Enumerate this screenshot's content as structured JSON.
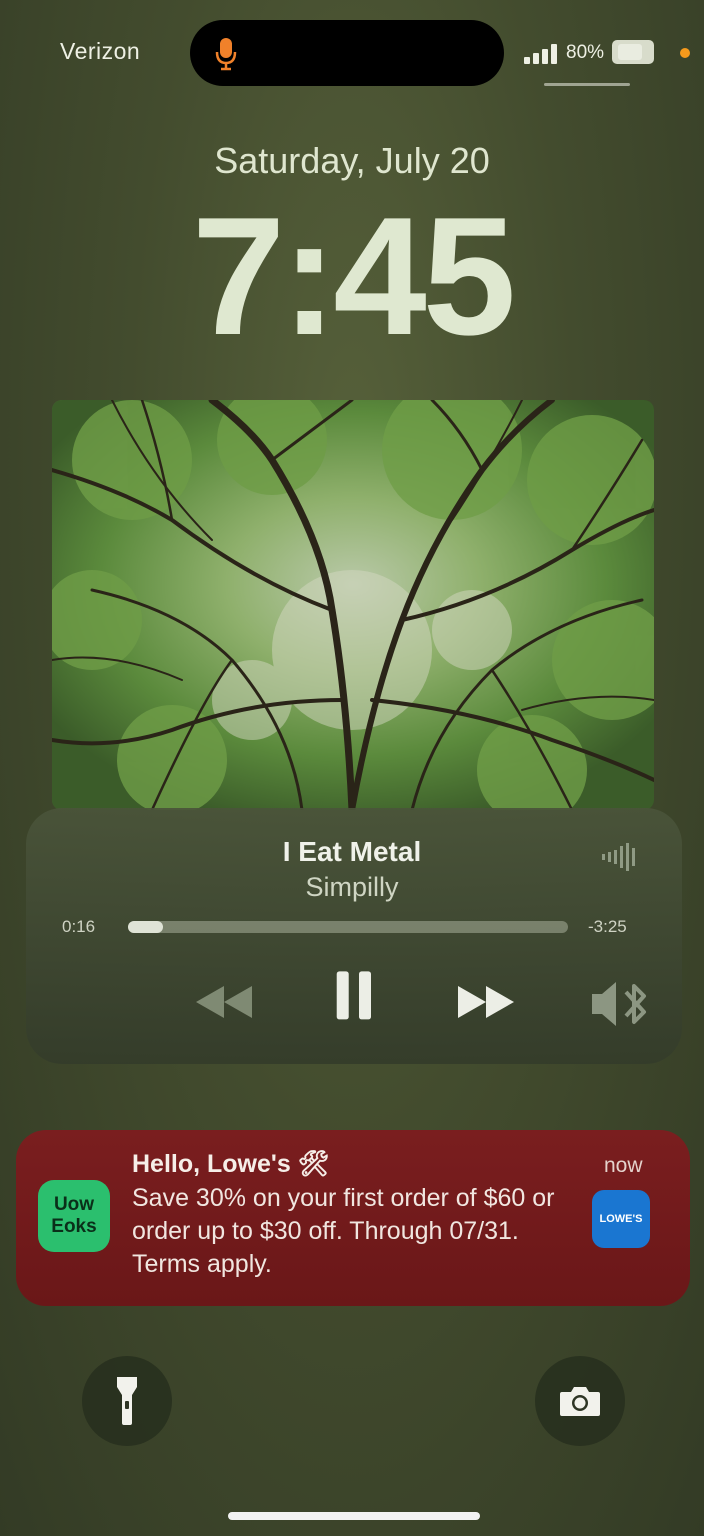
{
  "status_bar": {
    "carrier": "Verizon",
    "battery_label": "80%",
    "orange_dot_color": "#f59a1c",
    "mic_color": "#f0812a"
  },
  "lock_screen": {
    "date": "Saturday, July 20",
    "time": "7:45"
  },
  "now_playing": {
    "title": "I Eat Metal",
    "artist": "Simpilly",
    "elapsed": "0:16",
    "remaining": "-3:25",
    "progress_fraction": 0.08,
    "icons": [
      "rewind-icon",
      "pause-icon",
      "fast-forward-icon",
      "speaker-bluetooth-icon",
      "waveform-icon"
    ]
  },
  "notification": {
    "app_icon_text": "Uow Eoks",
    "title": "Hello, Lowe's 🛠",
    "time": "now",
    "body": "Save 30% on your first order of $60 or order up to $30 off. Through 07/31. Terms apply.",
    "thumbnail_text": "LOWE'S",
    "background_color": "#6e1a1b"
  },
  "bottom_actions": {
    "left_icon": "flashlight-icon",
    "right_icon": "camera-icon"
  }
}
